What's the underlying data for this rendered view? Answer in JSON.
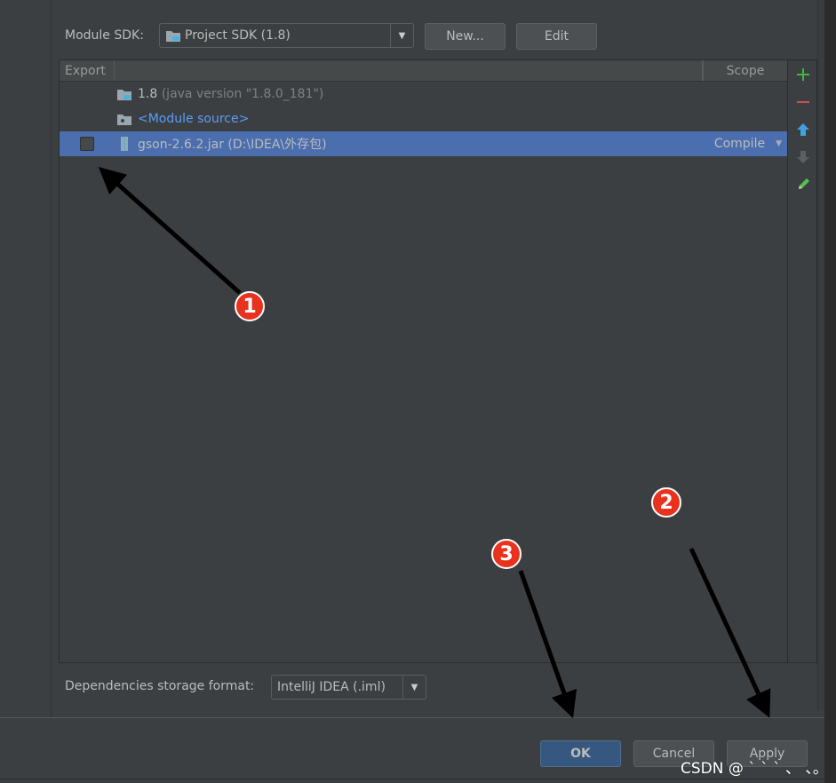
{
  "module_sdk": {
    "label": "Module SDK:",
    "value": "Project SDK (1.8)",
    "new_label": "New...",
    "edit_label": "Edit"
  },
  "table": {
    "columns": [
      "Export",
      "Scope"
    ],
    "rows": [
      {
        "name": "1.8",
        "detail": " (java version \"1.8.0_181\")",
        "icon": "jdk-folder-icon"
      },
      {
        "name": "<Module source>",
        "icon": "module-source-folder-icon"
      },
      {
        "name": "gson-2.6.2.jar (D:\\IDEA\\外存包)",
        "icon": "jar-icon",
        "scope": "Compile",
        "selected": true,
        "exported": false
      }
    ]
  },
  "toolbar": {
    "icons": [
      "add-icon",
      "remove-icon",
      "move-up-icon",
      "move-down-icon",
      "edit-pencil-icon"
    ]
  },
  "storage": {
    "label": "Dependencies storage format:",
    "value": "IntelliJ IDEA (.iml)"
  },
  "footer": {
    "ok_label": "OK",
    "cancel_label": "Cancel",
    "apply_label": "Apply"
  },
  "annotations": {
    "badge1": "1",
    "badge2": "2",
    "badge3": "3",
    "watermark": "CSDN @ ` ` ` 、 、。"
  },
  "colors": {
    "background": "#3c3f41",
    "selection": "#4b6eaf",
    "primary_button": "#365880",
    "link_blue": "#589df6",
    "add_green": "#3fb63f",
    "remove_red": "#c75450",
    "badge_red": "#e8321e"
  }
}
